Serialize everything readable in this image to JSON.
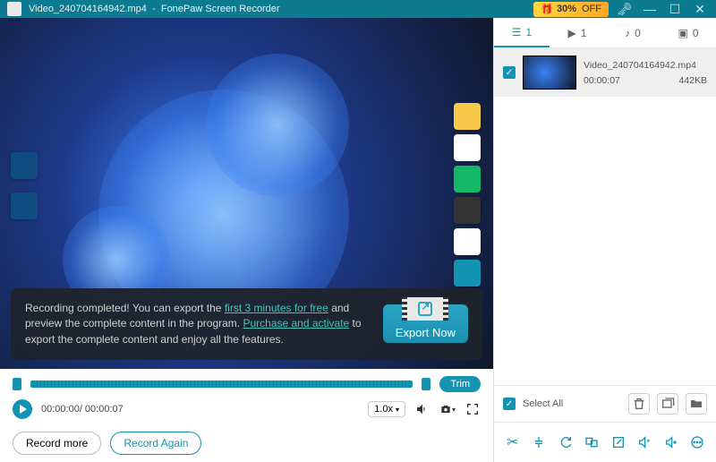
{
  "titlebar": {
    "filename": "Video_240704164942.mp4",
    "separator": "-",
    "app": "FonePaw Screen Recorder",
    "promo_pct": "30%",
    "promo_suffix": "OFF"
  },
  "banner": {
    "line1_pre": "Recording completed! You can export the ",
    "link1": "first 3 minutes for free",
    "line2_pre": " and preview the complete content in the program. ",
    "link2": "Purchase and activate",
    "line2_post": " to export the complete content and enjoy all the features.",
    "export_btn": "Export Now"
  },
  "trim": {
    "label": "Trim"
  },
  "controls": {
    "timecode": "00:00:00/ 00:00:07",
    "speed": "1.0x"
  },
  "buttons": {
    "record_more": "Record more",
    "record_again": "Record Again"
  },
  "tabs": {
    "list_count": "1",
    "video_count": "1",
    "audio_count": "0",
    "image_count": "0"
  },
  "items": [
    {
      "name": "Video_240704164942.mp4",
      "duration": "00:00:07",
      "size": "442KB"
    }
  ],
  "right_footer": {
    "select_all": "Select All"
  }
}
